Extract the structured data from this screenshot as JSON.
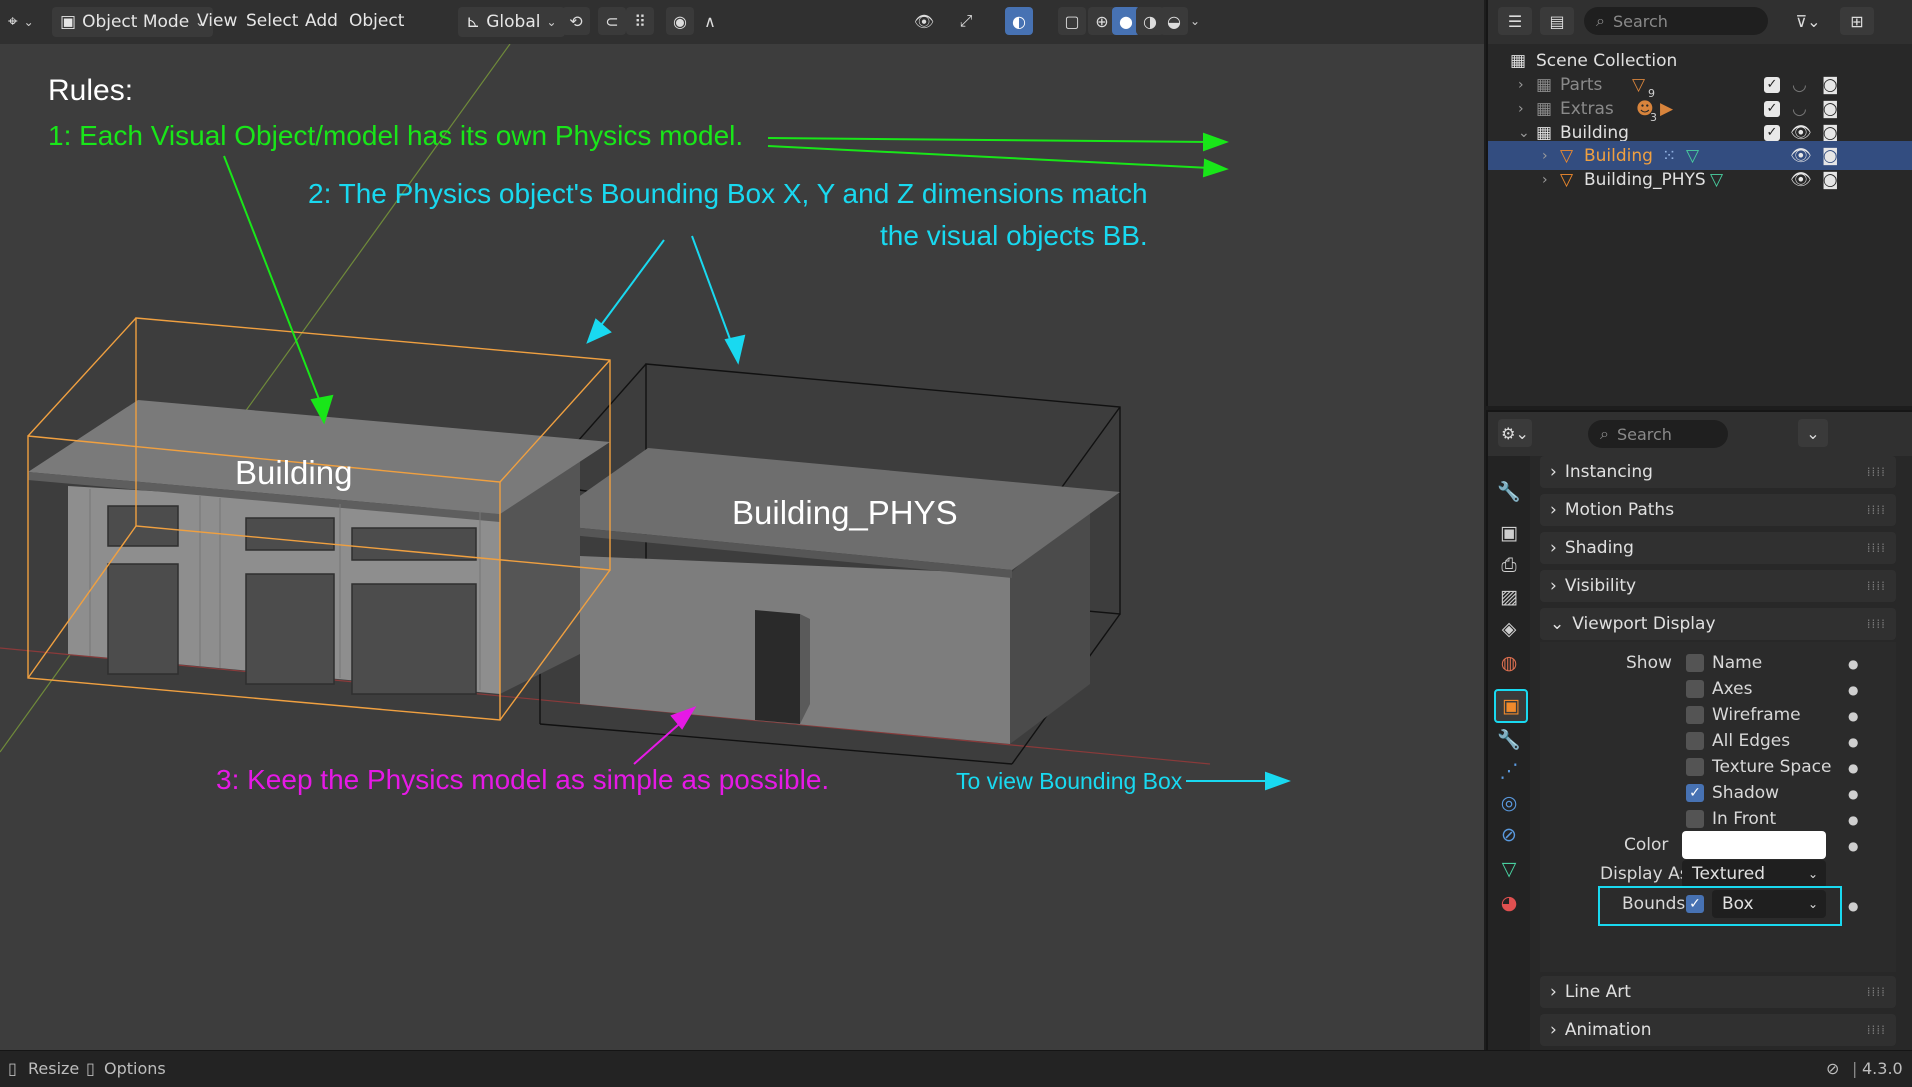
{
  "header": {
    "mode": "Object Mode",
    "menu": [
      "View",
      "Select",
      "Add",
      "Object"
    ],
    "orientation": "Global"
  },
  "viewport": {
    "labels": {
      "building": "Building",
      "phys": "Building_PHYS"
    },
    "annotations": {
      "rules": "Rules:",
      "rule1": "1: Each Visual Object/model has its own Physics model.",
      "rule2_line1": "2: The Physics object's Bounding Box X, Y and Z dimensions match",
      "rule2_line2": "the visual objects BB.",
      "rule3": "3: Keep the Physics model as simple as possible.",
      "bounds_tip": "To view Bounding Box"
    },
    "colors": {
      "rule1": "#19e619",
      "rule2": "#19d9f0",
      "rule3": "#e619e6"
    }
  },
  "outliner": {
    "search_placeholder": "Search",
    "scene_collection": "Scene Collection",
    "items": [
      {
        "name": "Parts",
        "badge": "9"
      },
      {
        "name": "Extras",
        "badge": "3"
      },
      {
        "name": "Building"
      },
      {
        "name": "Building"
      },
      {
        "name": "Building_PHYS"
      }
    ]
  },
  "properties": {
    "search_placeholder": "Search",
    "panels": {
      "instancing": "Instancing",
      "motion_paths": "Motion Paths",
      "shading": "Shading",
      "visibility": "Visibility",
      "viewport_display": "Viewport Display",
      "line_art": "Line Art",
      "animation": "Animation"
    },
    "show_label": "Show",
    "show_options": [
      "Name",
      "Axes",
      "Wireframe",
      "All Edges",
      "Texture Space",
      "Shadow",
      "In Front"
    ],
    "shadow_checked": true,
    "color_label": "Color",
    "color_value": "#ffffff",
    "display_as_label": "Display As",
    "display_as_value": "Textured",
    "bounds_label": "Bounds",
    "bounds_value": "Box",
    "bounds_checked": true
  },
  "status": {
    "resize": "Resize",
    "options": "Options",
    "version": "4.3.0"
  }
}
